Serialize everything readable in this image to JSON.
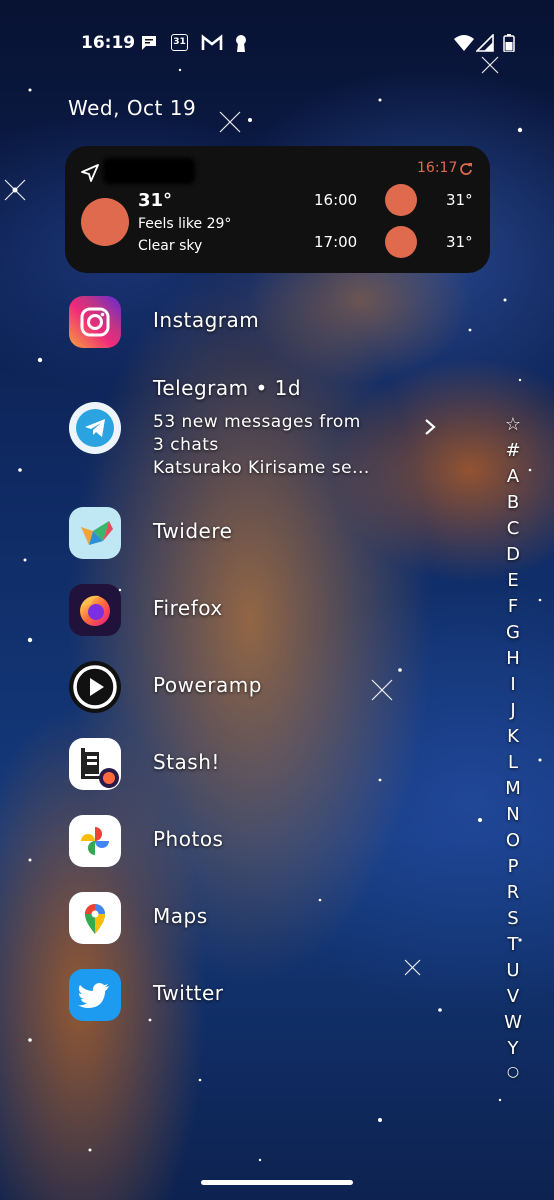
{
  "status_bar": {
    "time": "16:19",
    "calendar_day": "31",
    "icons": [
      "chat-notification-icon",
      "calendar-icon",
      "gmail-icon",
      "keyhole-icon",
      "wifi-icon",
      "signal-icon",
      "battery-icon"
    ]
  },
  "date": "Wed, Oct 19",
  "weather_widget": {
    "updated_time": "16:17",
    "current_temp": "31°",
    "feels_like": "Feels like 29°",
    "condition": "Clear sky",
    "forecast": [
      {
        "time": "16:00",
        "temp": "31°"
      },
      {
        "time": "17:00",
        "temp": "31°"
      }
    ],
    "accent_color": "#e06a4e"
  },
  "apps": [
    {
      "name": "Instagram",
      "icon": "instagram-icon"
    },
    {
      "name": "Twidere",
      "icon": "twidere-icon"
    },
    {
      "name": "Firefox",
      "icon": "firefox-icon"
    },
    {
      "name": "Poweramp",
      "icon": "poweramp-icon"
    },
    {
      "name": "Stash!",
      "icon": "stash-icon"
    },
    {
      "name": "Photos",
      "icon": "photos-icon"
    },
    {
      "name": "Maps",
      "icon": "maps-icon"
    },
    {
      "name": "Twitter",
      "icon": "twitter-icon"
    }
  ],
  "telegram": {
    "title": "Telegram • 1d",
    "line1": "53 new messages from",
    "line2": "3 chats",
    "line3": "Katsurako Kirisame se..."
  },
  "alphabet_index": [
    "☆",
    "#",
    "A",
    "B",
    "C",
    "D",
    "E",
    "F",
    "G",
    "H",
    "I",
    "J",
    "K",
    "L",
    "M",
    "N",
    "O",
    "P",
    "R",
    "S",
    "T",
    "U",
    "V",
    "W",
    "Y",
    "○"
  ]
}
